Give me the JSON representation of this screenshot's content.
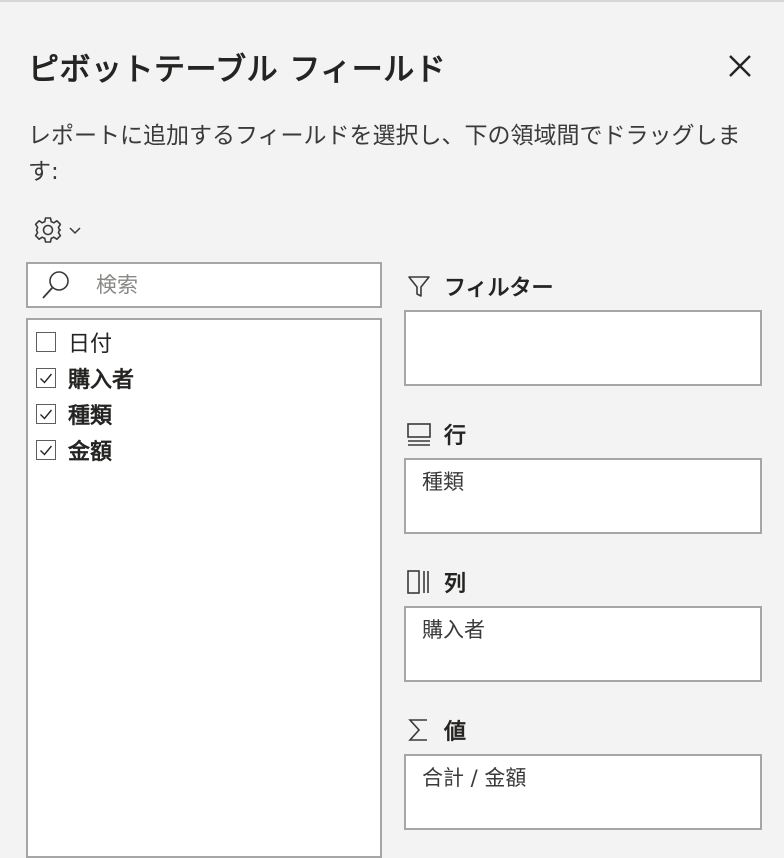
{
  "panel": {
    "title": "ピボットテーブル フィールド",
    "description": "レポートに追加するフィールドを選択し、下の領域間でドラッグします:",
    "close_icon": "close-icon",
    "settings_icon": "gear-icon"
  },
  "search": {
    "placeholder": "検索",
    "value": ""
  },
  "fields": [
    {
      "label": "日付",
      "checked": false
    },
    {
      "label": "購入者",
      "checked": true
    },
    {
      "label": "種類",
      "checked": true
    },
    {
      "label": "金額",
      "checked": true
    }
  ],
  "areas": {
    "filters": {
      "label": "フィルター",
      "icon": "filter-icon",
      "items": []
    },
    "rows": {
      "label": "行",
      "icon": "rows-icon",
      "items": [
        "種類"
      ]
    },
    "columns": {
      "label": "列",
      "icon": "columns-icon",
      "items": [
        "購入者"
      ]
    },
    "values": {
      "label": "値",
      "icon": "sigma-icon",
      "items": [
        "合計 / 金額"
      ]
    }
  },
  "colors": {
    "background": "#f3f3f3",
    "border": "#a6a6a6",
    "text": "#252423"
  }
}
